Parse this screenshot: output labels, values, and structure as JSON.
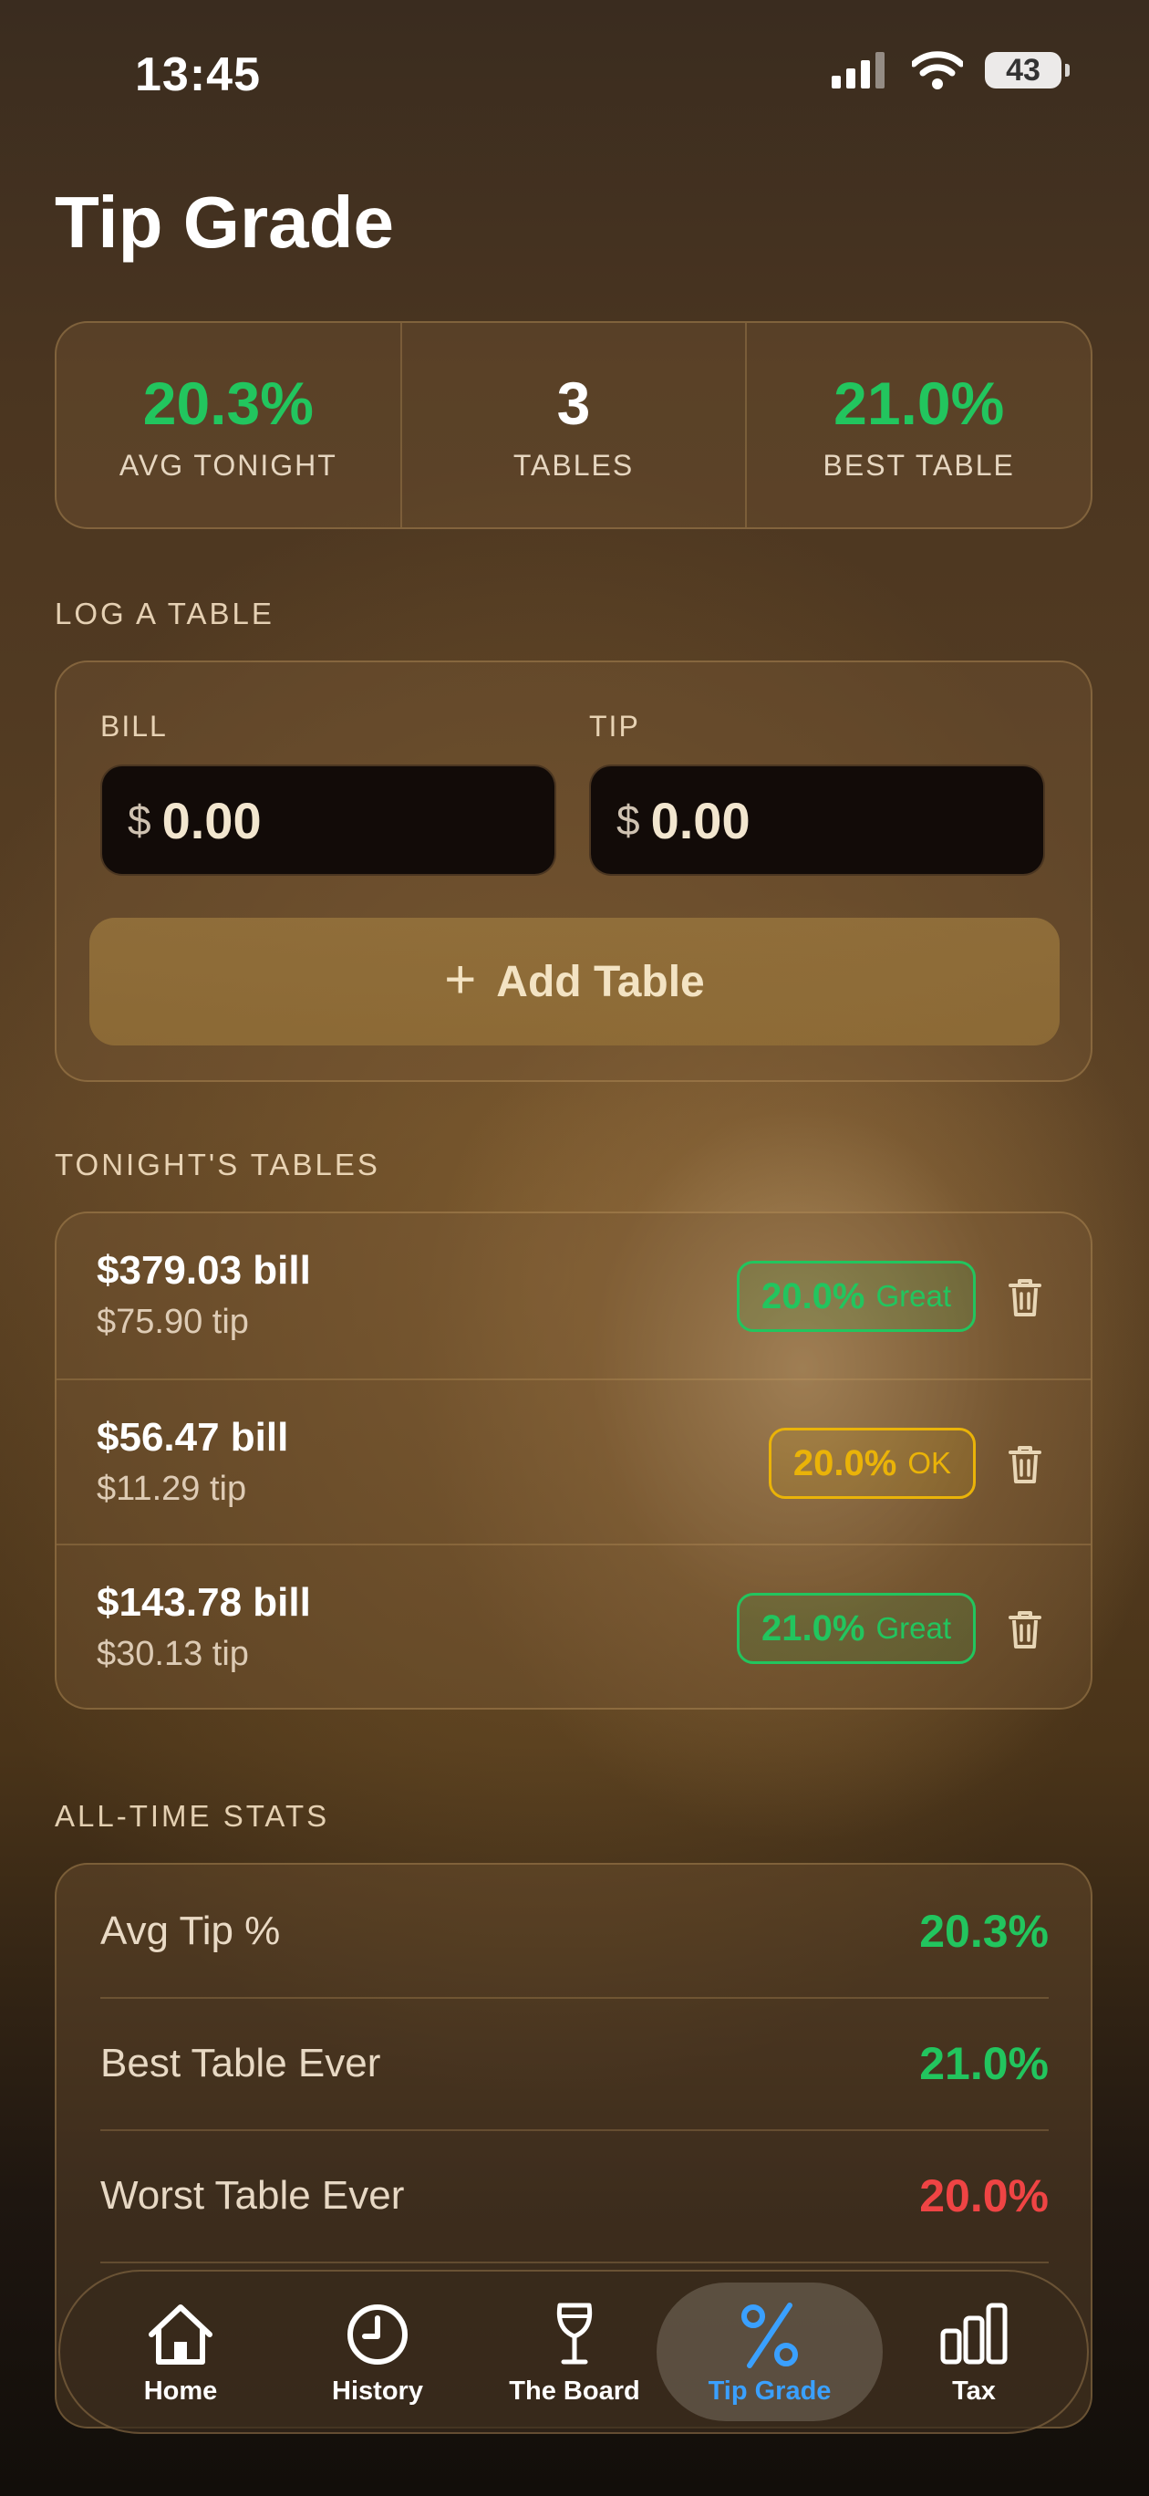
{
  "status": {
    "time": "13:45",
    "battery": "43"
  },
  "page": {
    "title": "Tip Grade"
  },
  "summary": [
    {
      "value": "20.3%",
      "label": "AVG TONIGHT",
      "color": "#22c55e"
    },
    {
      "value": "3",
      "label": "TABLES",
      "color": "#ffffff"
    },
    {
      "value": "21.0%",
      "label": "BEST TABLE",
      "color": "#22c55e"
    }
  ],
  "log": {
    "section": "LOG A TABLE",
    "bill_label": "BILL",
    "tip_label": "TIP",
    "currency": "$",
    "bill_value": "0.00",
    "tip_value": "0.00",
    "add_label": "Add Table"
  },
  "tables": {
    "section": "TONIGHT'S TABLES",
    "rows": [
      {
        "bill": "$379.03 bill",
        "tip": "$75.90 tip",
        "pct": "20.0%",
        "grade": "Great"
      },
      {
        "bill": "$56.47 bill",
        "tip": "$11.29 tip",
        "pct": "20.0%",
        "grade": "OK"
      },
      {
        "bill": "$143.78 bill",
        "tip": "$30.13 tip",
        "pct": "21.0%",
        "grade": "Great"
      }
    ]
  },
  "stats": {
    "section": "ALL-TIME STATS",
    "rows": [
      {
        "label": "Avg Tip %",
        "value": "20.3%"
      },
      {
        "label": "Best Table Ever",
        "value": "21.0%"
      },
      {
        "label": "Worst Table Ever",
        "value": "20.0%"
      }
    ]
  },
  "tabs": [
    {
      "label": "Home",
      "icon": "home-icon"
    },
    {
      "label": "History",
      "icon": "clock-icon"
    },
    {
      "label": "The Board",
      "icon": "wine-glass-icon"
    },
    {
      "label": "Tip Grade",
      "icon": "percent-icon"
    },
    {
      "label": "Tax",
      "icon": "bar-chart-icon"
    }
  ],
  "colors": {
    "green": "#22c55e",
    "yellow": "#eab308",
    "red": "#ef4444",
    "active_tab": "#3aa0ff"
  }
}
